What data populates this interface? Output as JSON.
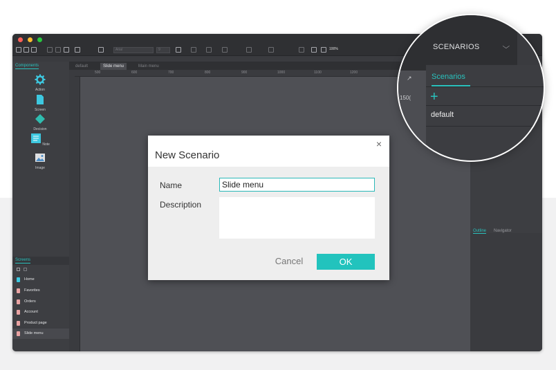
{
  "app": {
    "toolbar": {
      "font_name": "Arial",
      "font_size": "9",
      "zoom": "100%"
    },
    "left_panel": {
      "components_tab": "Components",
      "components": [
        {
          "label": "Action",
          "icon": "gear-icon"
        },
        {
          "label": "Screen",
          "icon": "document-icon"
        },
        {
          "label": "Decision",
          "icon": "diamond-icon"
        },
        {
          "label": "Note",
          "icon": "note-icon"
        },
        {
          "label": "Image",
          "icon": "image-icon"
        }
      ],
      "screens_tab": "Screens",
      "screens": [
        "Home",
        "Favorites",
        "Orders",
        "Account",
        "Product page",
        "Slide menu"
      ]
    },
    "doc_tabs": [
      "default",
      "Slide menu",
      "Main menu"
    ],
    "ruler": [
      "500",
      "600",
      "700",
      "800",
      "900",
      "1000",
      "1100",
      "1200"
    ],
    "right_panel": {
      "tab_outline": "Outline",
      "tab_navigator": "Navigator"
    }
  },
  "dialog": {
    "title": "New Scenario",
    "close_symbol": "×",
    "name_label": "Name",
    "name_value": "Slide menu",
    "description_label": "Description",
    "description_value": "",
    "cancel_label": "Cancel",
    "ok_label": "OK"
  },
  "magnifier": {
    "header_title": "SCENARIOS",
    "header_chevron": "⌵",
    "tab_label": "Scenarios",
    "add_symbol": "+",
    "items": [
      "default"
    ],
    "ruler_fragment": "150(",
    "expand_symbol": "↗"
  },
  "colors": {
    "accent": "#22c3bd",
    "window_bg": "#3a3b3f",
    "canvas_bg": "#4f5055"
  }
}
